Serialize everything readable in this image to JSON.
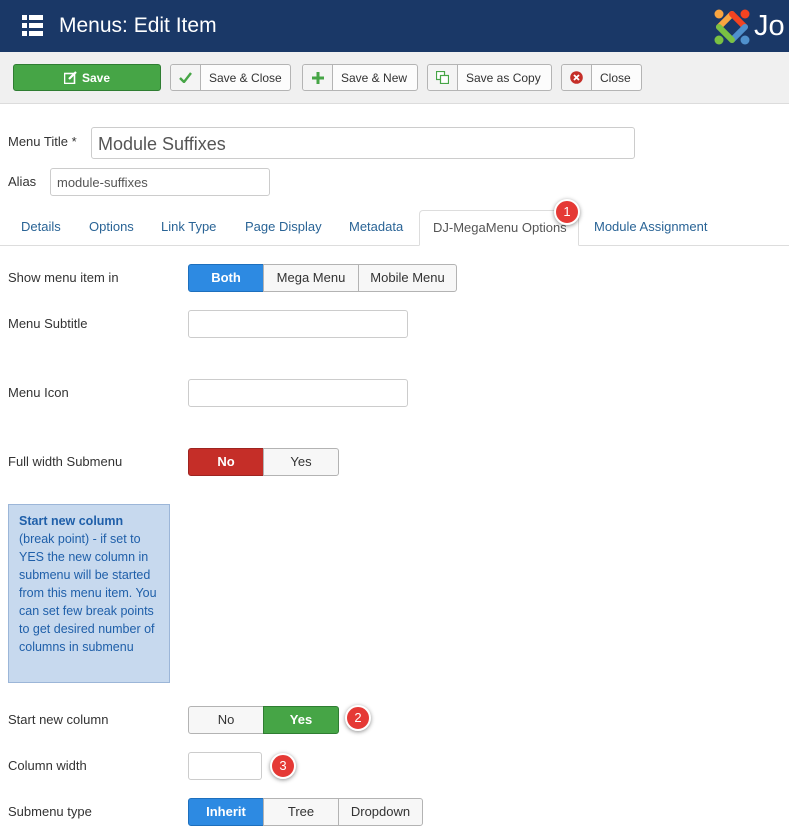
{
  "header": {
    "title": "Menus: Edit Item",
    "menu_icon": "list-icon",
    "logo_text": "Jo",
    "logo_colors": [
      "#f44321",
      "#5091cd",
      "#7ac143",
      "#f9a541"
    ]
  },
  "toolbar": {
    "save": "Save",
    "save_close": "Save & Close",
    "save_new": "Save & New",
    "save_copy": "Save as Copy",
    "close": "Close"
  },
  "form": {
    "menu_title_label": "Menu Title *",
    "menu_title_value": "Module Suffixes",
    "alias_label": "Alias",
    "alias_value": "module-suffixes"
  },
  "tabs": [
    {
      "label": "Details"
    },
    {
      "label": "Options"
    },
    {
      "label": "Link Type"
    },
    {
      "label": "Page Display"
    },
    {
      "label": "Metadata"
    },
    {
      "label": "DJ-MegaMenu Options",
      "active": true
    },
    {
      "label": "Module Assignment"
    }
  ],
  "fields": {
    "show_in": {
      "label": "Show menu item in",
      "options": [
        "Both",
        "Mega Menu",
        "Mobile Menu"
      ],
      "selected": "Both"
    },
    "subtitle": {
      "label": "Menu Subtitle",
      "value": ""
    },
    "icon": {
      "label": "Menu Icon",
      "value": ""
    },
    "full_width": {
      "label": "Full width Submenu",
      "options": [
        "No",
        "Yes"
      ],
      "selected": "No"
    },
    "info": {
      "title": "Start new column",
      "text": "(break point) - if set to YES the new column in submenu will be started from this menu item. You can set few break points to get desired number of columns in submenu"
    },
    "new_column": {
      "label": "Start new column",
      "options": [
        "No",
        "Yes"
      ],
      "selected": "Yes"
    },
    "column_width": {
      "label": "Column width",
      "value": ""
    },
    "submenu_type": {
      "label": "Submenu type",
      "options": [
        "Inherit",
        "Tree",
        "Dropdown"
      ],
      "selected": "Inherit"
    }
  },
  "badges": [
    "1",
    "2",
    "3"
  ],
  "colors": {
    "header_bg": "#1a3867",
    "save_green": "#46a546",
    "active_blue": "#2d8ae2",
    "no_red": "#c52e28",
    "badge_red": "#e53935",
    "tab_link": "#2a6496"
  }
}
